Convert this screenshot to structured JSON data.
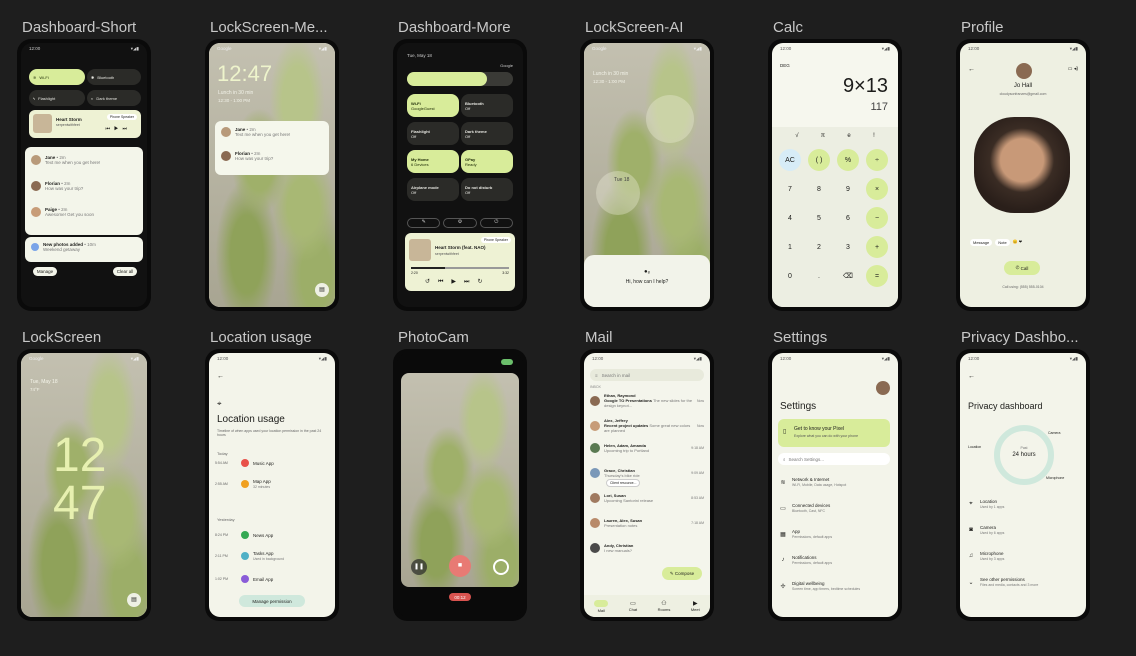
{
  "labels": [
    "Dashboard-Short",
    "LockScreen-Me...",
    "Dashboard-More",
    "LockScreen-AI",
    "Calc",
    "Profile",
    "LockScreen",
    "Location usage",
    "PhotoCam",
    "Mail",
    "Settings",
    "Privacy Dashbo..."
  ],
  "status_time": "12:00",
  "dash_short": {
    "tiles": [
      "Wi-Fi",
      "Bluetooth",
      "Flashlight",
      "Dark theme"
    ],
    "media_title": "Heart Storm",
    "media_artist": "serpentwithfeet",
    "media_badge": "Phone Speaker",
    "notifs": [
      {
        "name": "Jane",
        "time": "• 2m",
        "text": "Text me when you get here!"
      },
      {
        "name": "Florian",
        "time": "• 2m",
        "text": "How was your trip?"
      },
      {
        "name": "Paige",
        "time": "• 2m",
        "text": "Awesome! Get you soon"
      }
    ],
    "photos_title": "New photos added",
    "photos_time": "• 10m",
    "photos_text": "Weekend getaway",
    "manage": "Manage",
    "clear": "Clear all"
  },
  "lock_me": {
    "carrier": "Google",
    "time": "12:47",
    "event": "Lunch in 30 min",
    "event_time": "12:30 - 1:00 PM",
    "notifs": [
      {
        "name": "Jane",
        "time": "• 2m",
        "text": "Text me when you get here!"
      },
      {
        "name": "Florian",
        "time": "• 2m",
        "text": "How was your trip?"
      }
    ]
  },
  "dash_more": {
    "date": "Tue, May 18",
    "carrier": "Google",
    "tiles": [
      {
        "t": "Wi-Fi",
        "s": "GoogleGuest"
      },
      {
        "t": "Bluetooth",
        "s": "Off"
      },
      {
        "t": "Flashlight",
        "s": "Off"
      },
      {
        "t": "Dark theme",
        "s": "Off"
      },
      {
        "t": "My Home",
        "s": "6 Devices"
      },
      {
        "t": "GPay",
        "s": "Ready"
      },
      {
        "t": "Airplane mode",
        "s": "Off"
      },
      {
        "t": "Do not disturb",
        "s": "Off"
      }
    ],
    "media_title": "Heart Storm (feat. NAO)",
    "media_artist": "serpentwithfeet",
    "media_badge": "Phone Speaker",
    "t_start": "2:20",
    "t_end": "3:32"
  },
  "lock_ai": {
    "carrier": "Google",
    "event": "Lunch in 30 min",
    "event_time": "12:30 - 1:00 PM",
    "date": "Tue 18",
    "prompt": "Hi, how can I help?"
  },
  "calc": {
    "mode": "DEG",
    "expr": "9×13",
    "result": "117",
    "sci": [
      "√",
      "π",
      "e",
      "!"
    ],
    "keys": [
      "AC",
      "( )",
      "%",
      "÷",
      "7",
      "8",
      "9",
      "×",
      "4",
      "5",
      "6",
      "−",
      "1",
      "2",
      "3",
      "+",
      "0",
      ".",
      "⌫",
      "="
    ]
  },
  "profile": {
    "name": "Jo Hall",
    "email": "cloudysonfranzes@gmail.com",
    "actions": [
      "Message",
      "Note"
    ],
    "call": "Call",
    "footer": "Call using: (555) 555-0104"
  },
  "lock": {
    "carrier": "Google",
    "date": "Tue, May 18",
    "weather": "74°F",
    "hour": "12",
    "minute": "47"
  },
  "location": {
    "title": "Location usage",
    "desc": "Timeline of when apps used your location permission in the past 24 hours",
    "today": "Today",
    "yesterday": "Yesterday",
    "items": [
      {
        "time": "5:54 AM",
        "app": "Music App",
        "sub": ""
      },
      {
        "time": "2:55 AM",
        "app": "Map App",
        "sub": "32 minutes"
      },
      {
        "time": "8:24 PM",
        "app": "News App",
        "sub": ""
      },
      {
        "time": "2:11 PM",
        "app": "Tasks App",
        "sub": "Used in background"
      },
      {
        "time": "1:02 PM",
        "app": "Email App",
        "sub": ""
      }
    ],
    "manage": "Manage permission"
  },
  "photocam": {
    "timer": "00:12"
  },
  "mail": {
    "search": "Search in mail",
    "inbox": "INBOX",
    "items": [
      {
        "from": "Ethan, Raymond",
        "subj": "Google TO Presentations",
        "snip": "The new slides for the design keynot...",
        "time": "Now"
      },
      {
        "from": "Alex, Jeffrey",
        "subj": "Recent project updates",
        "snip": "Some great new colors are planned",
        "time": "Now"
      },
      {
        "from": "Helen, Adam, Amanda",
        "subj": "",
        "snip": "Upcoming trip to Portland",
        "time": "9:18 AM"
      },
      {
        "from": "Grace, Christian",
        "subj": "",
        "snip": "Thursday's bike ride",
        "time": "9:09 AM"
      },
      {
        "from": "Lori, Susan",
        "subj": "",
        "snip": "Upcoming Santorini release",
        "time": "8:53 AM"
      },
      {
        "from": "Lauren, Alex, Susan",
        "subj": "",
        "snip": "Presentation notes",
        "time": "7:18 AM"
      },
      {
        "from": "Andy, Christian",
        "subj": "",
        "snip": "I new manuals?",
        "time": ""
      }
    ],
    "attach": "Client resource...",
    "compose": "Compose",
    "tabs": [
      "Mail",
      "Chat",
      "Rooms",
      "Meet"
    ]
  },
  "settings": {
    "title": "Settings",
    "promo_t": "Get to know your Pixel",
    "promo_s": "Explore what you can do with your phone",
    "search": "Search Settings...",
    "items": [
      {
        "t": "Network & Internet",
        "s": "Wi-Fi, Mobile, Data usage, Hotspot"
      },
      {
        "t": "Connected devices",
        "s": "Bluetooth, Cast, NFC"
      },
      {
        "t": "App",
        "s": "Permissions, default apps"
      },
      {
        "t": "Notifications",
        "s": "Permissions, default apps"
      },
      {
        "t": "Digital wellbeing",
        "s": "Screen time, app timers, bedtime schedules"
      }
    ]
  },
  "privacy": {
    "title": "Privacy dashboard",
    "center_t": "Past",
    "center_v": "24 hours",
    "labels": [
      "Location",
      "Camera",
      "Microphone"
    ],
    "items": [
      {
        "t": "Location",
        "s": "Used by 1 apps"
      },
      {
        "t": "Camera",
        "s": "Used by 6 apps"
      },
      {
        "t": "Microphone",
        "s": "Used by 3 apps"
      },
      {
        "t": "See other permissions",
        "s": "Files and media, contacts and 3 more"
      }
    ]
  }
}
